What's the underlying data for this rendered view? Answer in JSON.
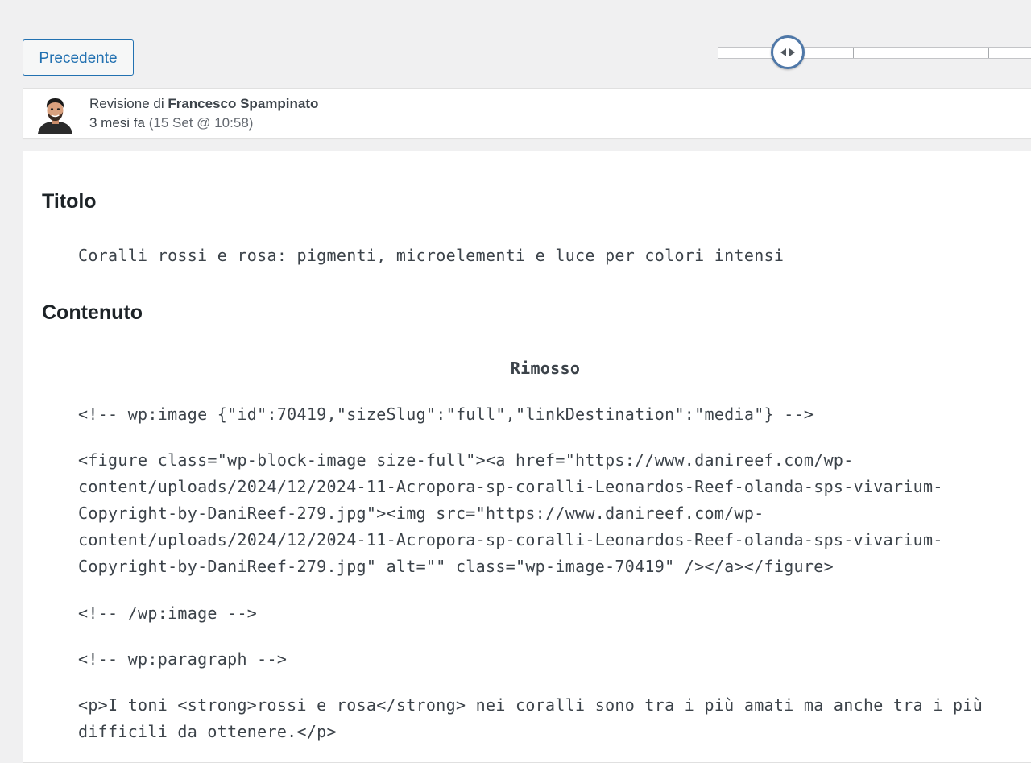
{
  "navigation": {
    "previous_label": "Precedente"
  },
  "revision": {
    "prefix": "Revisione di ",
    "author": "Francesco Spampinato",
    "relative_time": "3 mesi fa",
    "date_detail": "(15 Set @ 10:58)"
  },
  "sections": {
    "title_heading": "Titolo",
    "title_value": "Coralli rossi e rosa: pigmenti, microelementi e luce per colori intensi",
    "content_heading": "Contenuto",
    "removed_label": "Rimosso"
  },
  "content_lines": [
    "<!-- wp:image {\"id\":70419,\"sizeSlug\":\"full\",\"linkDestination\":\"media\"} -->",
    "<figure class=\"wp-block-image size-full\"><a href=\"https://www.danireef.com/wp-\ncontent/uploads/2024/12/2024-11-Acropora-sp-coralli-Leonardos-Reef-olanda-sps-vivarium-\nCopyright-by-DaniReef-279.jpg\"><img src=\"https://www.danireef.com/wp-\ncontent/uploads/2024/12/2024-11-Acropora-sp-coralli-Leonardos-Reef-olanda-sps-vivarium-\nCopyright-by-DaniReef-279.jpg\" alt=\"\" class=\"wp-image-70419\" /></a></figure>",
    "<!-- /wp:image -->",
    "<!-- wp:paragraph -->",
    "<p>I toni <strong>rossi e rosa</strong> nei coralli sono tra i più amati ma anche tra i più\ndifficili da ottenere.</p>"
  ],
  "colors": {
    "accent": "#2271b1",
    "background": "#f0f0f1",
    "panel": "#ffffff",
    "handle_border": "#4f78a8"
  },
  "icons": {
    "slider_handle": "left-right-arrows-icon",
    "avatar": "user-avatar"
  }
}
